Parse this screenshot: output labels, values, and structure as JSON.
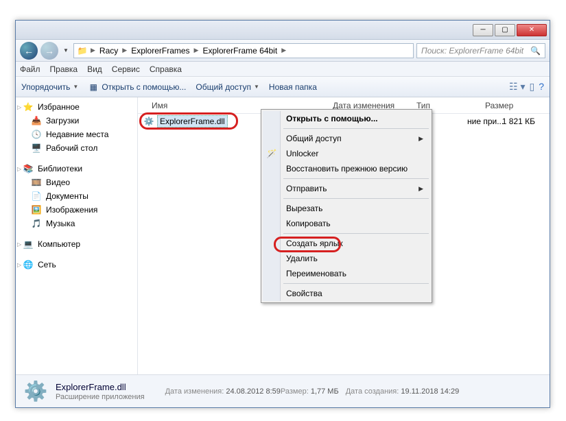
{
  "breadcrumb": {
    "seg1": "Racy",
    "seg2": "ExplorerFrames",
    "seg3": "ExplorerFrame 64bit"
  },
  "search": {
    "placeholder": "Поиск: ExplorerFrame 64bit"
  },
  "menu": {
    "file": "Файл",
    "edit": "Правка",
    "view": "Вид",
    "service": "Сервис",
    "help": "Справка"
  },
  "toolbar": {
    "organize": "Упорядочить",
    "openwith": "Открыть с помощью...",
    "share": "Общий доступ",
    "newfolder": "Новая папка"
  },
  "columns": {
    "name": "Имя",
    "date": "Дата изменения",
    "type": "Тип",
    "size": "Размер"
  },
  "sidebar": {
    "favorites": "Избранное",
    "downloads": "Загрузки",
    "recent": "Недавние места",
    "desktop": "Рабочий стол",
    "libraries": "Библиотеки",
    "videos": "Видео",
    "documents": "Документы",
    "pictures": "Изображения",
    "music": "Музыка",
    "computer": "Компьютер",
    "network": "Сеть"
  },
  "file": {
    "name": "ExplorerFrame.dll",
    "type_short": "ние при...",
    "size": "1 821 КБ"
  },
  "ctx": {
    "openwith": "Открыть с помощью...",
    "share": "Общий доступ",
    "unlocker": "Unlocker",
    "restore": "Восстановить прежнюю версию",
    "send": "Отправить",
    "cut": "Вырезать",
    "copy": "Копировать",
    "shortcut": "Создать ярлык",
    "delete": "Удалить",
    "rename": "Переименовать",
    "properties": "Свойства"
  },
  "detail": {
    "filename": "ExplorerFrame.dll",
    "filetype": "Расширение приложения",
    "mod_lbl": "Дата изменения:",
    "mod_val": "24.08.2012 8:59",
    "size_lbl": "Размер:",
    "size_val": "1,77 МБ",
    "created_lbl": "Дата создания:",
    "created_val": "19.11.2018 14:29"
  }
}
